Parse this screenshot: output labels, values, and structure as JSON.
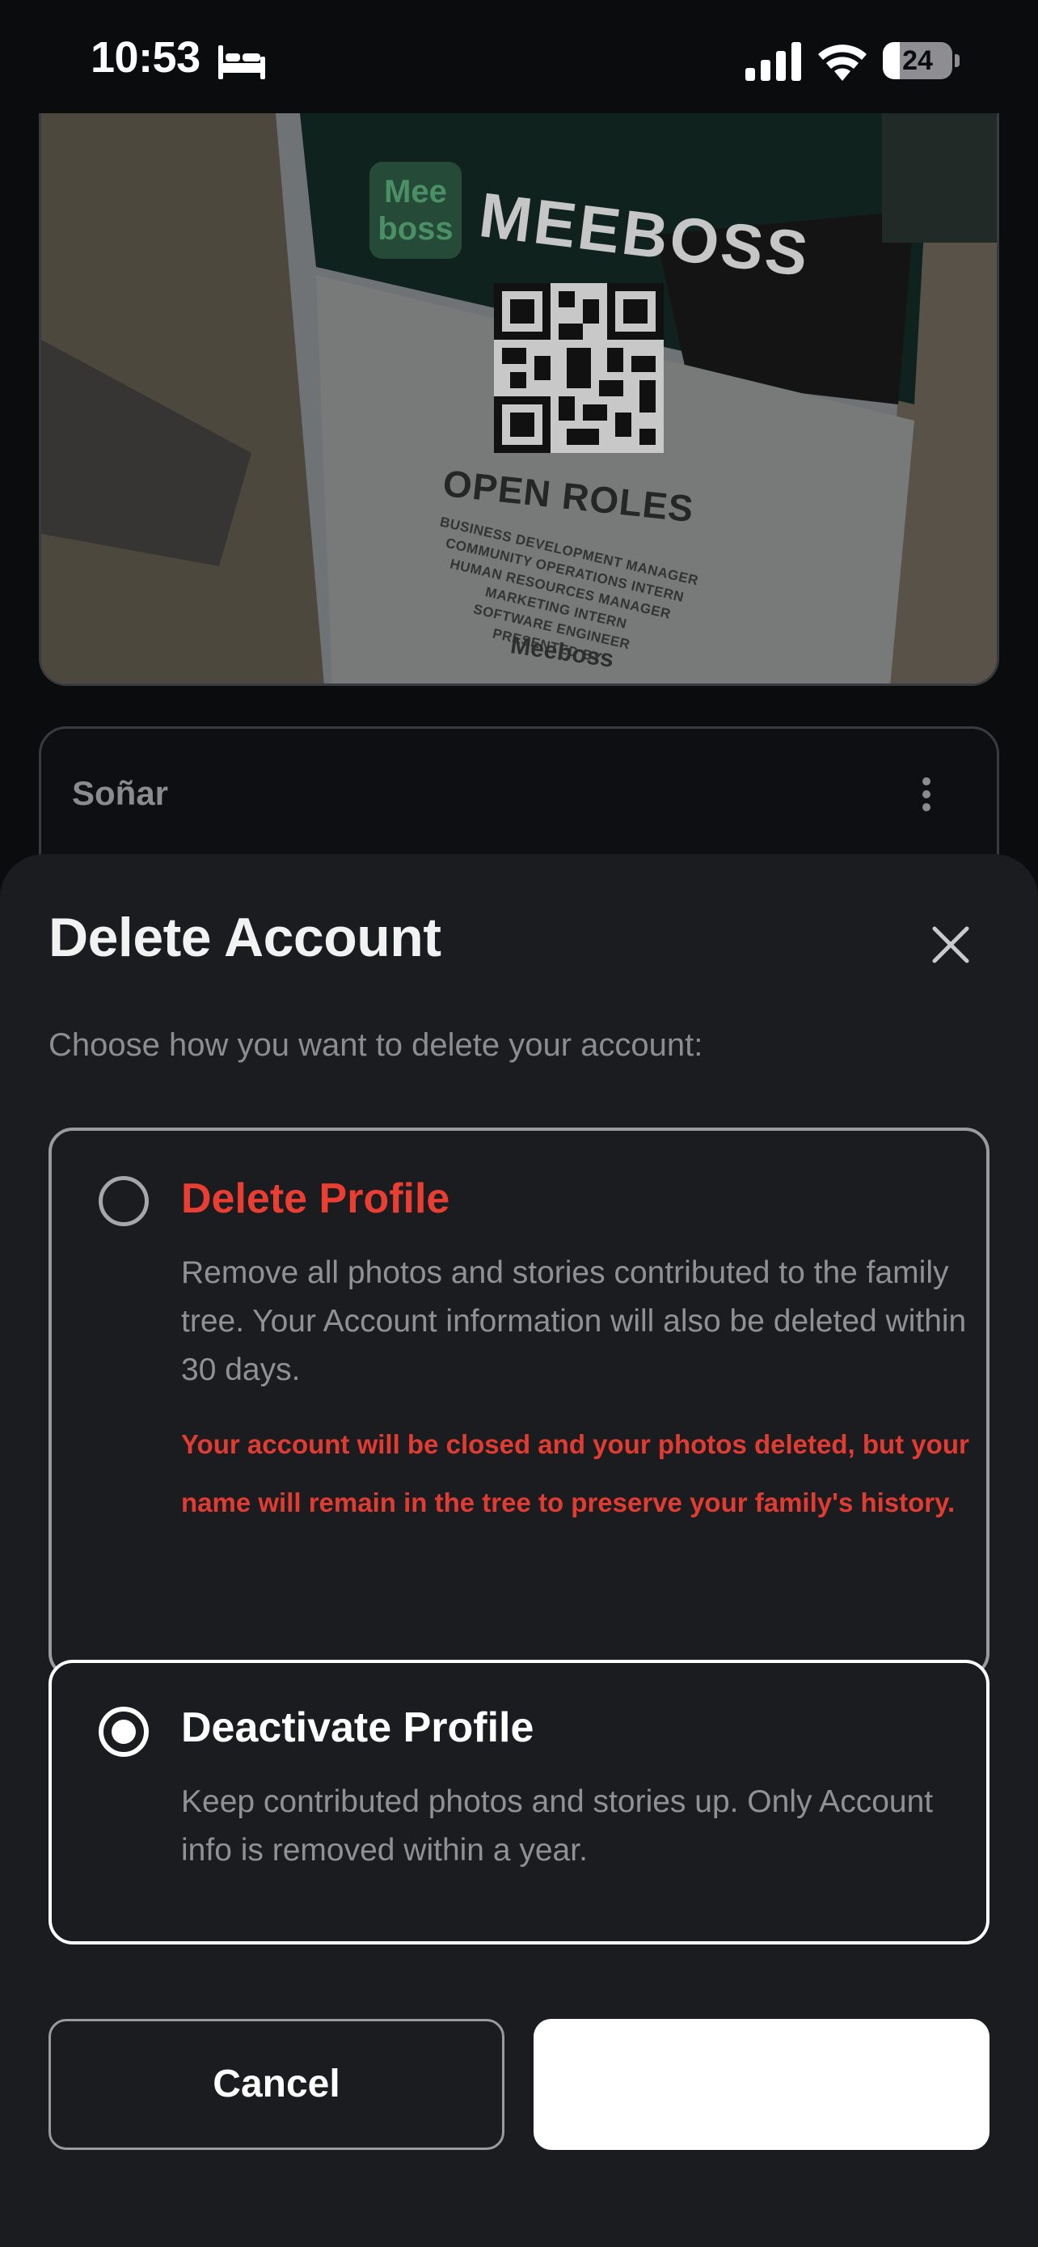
{
  "status_bar": {
    "time": "10:53",
    "battery_level": 24,
    "icons": [
      "bed-icon",
      "cellular-signal-icon",
      "wifi-icon",
      "battery-icon"
    ]
  },
  "background": {
    "photo": {
      "brand_logo": "Mee boss",
      "brand": "MEEBOSS",
      "heading": "OPEN ROLES",
      "roles": [
        "BUSINESS DEVELOPMENT MANAGER",
        "COMMUNITY OPERATIONS INTERN",
        "HUMAN RESOURCES MANAGER",
        "MARKETING INTERN",
        "SOFTWARE ENGINEER"
      ],
      "presented_by": "PRESENTED BY",
      "presenter": "Meeboss"
    },
    "post": {
      "author": "Soñar",
      "menu_icon": "more-vertical-icon"
    }
  },
  "sheet": {
    "title": "Delete Account",
    "close_icon": "close-icon",
    "subtitle": "Choose how you want to delete your account:",
    "options": [
      {
        "title": "Delete Profile",
        "description": "Remove all photos and stories contributed to the family tree. Your Account information will also be deleted within 30 days.",
        "warning": "Your account will be closed and your photos deleted, but your name will remain in the tree to preserve your family's history.",
        "selected": false
      },
      {
        "title": "Deactivate Profile",
        "description": "Keep contributed photos and stories up. Only Account info is removed within a year.",
        "selected": true
      }
    ],
    "cancel_label": "Cancel",
    "confirm_label": ""
  },
  "colors": {
    "background": "#0b0c0e",
    "sheet": "#1b1c1f",
    "danger": "#ea3e33",
    "muted_text": "#8c8d91",
    "selected_border": "#ffffff"
  }
}
